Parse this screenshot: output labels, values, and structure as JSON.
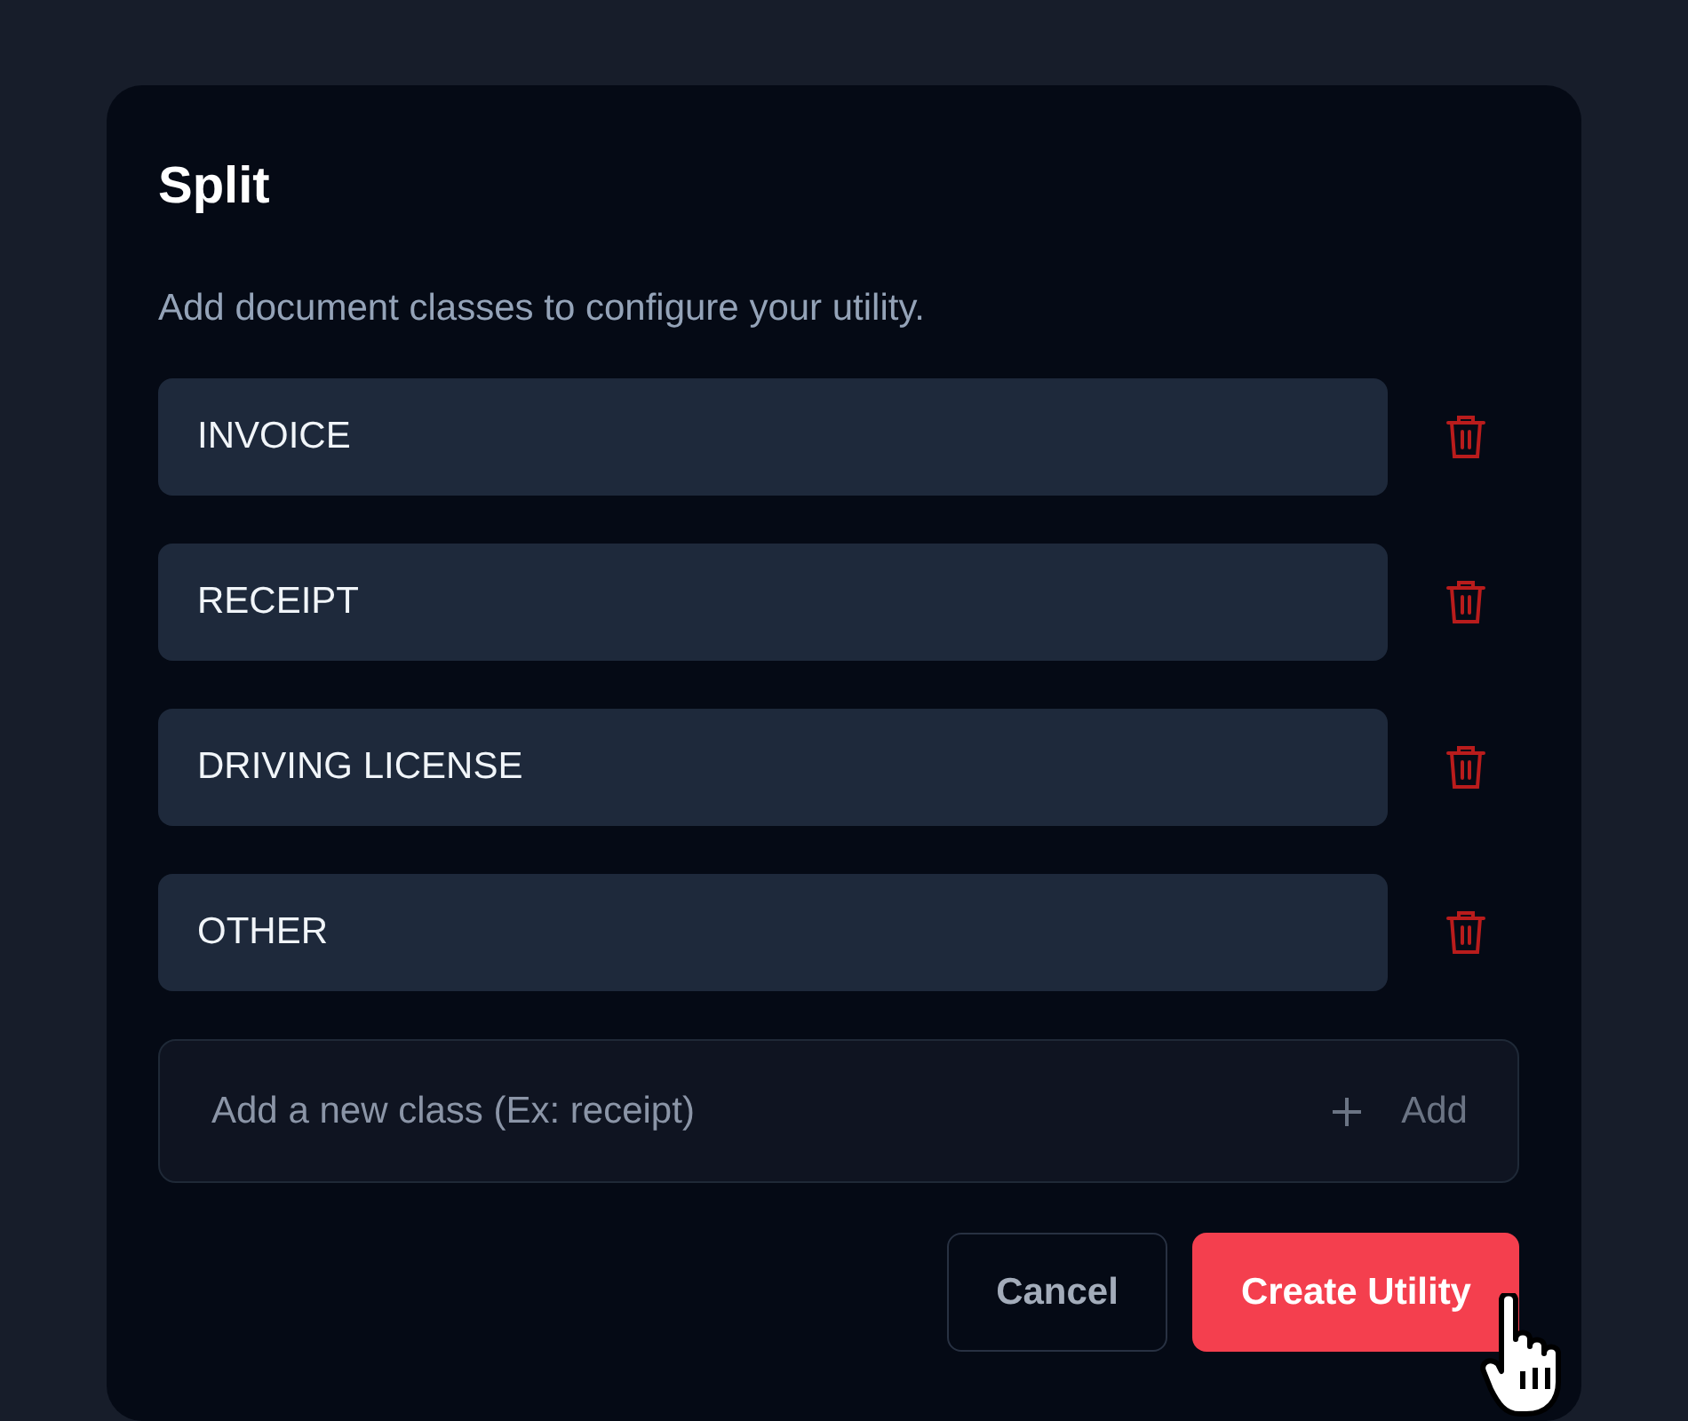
{
  "dialog": {
    "title": "Split",
    "description": "Add document classes to configure your utility.",
    "classes": [
      {
        "value": "INVOICE"
      },
      {
        "value": "RECEIPT"
      },
      {
        "value": "DRIVING LICENSE"
      },
      {
        "value": "OTHER"
      }
    ],
    "new_class": {
      "placeholder": "Add a new class (Ex: receipt)",
      "add_label": "Add"
    },
    "buttons": [
      {
        "label": "Cancel",
        "kind": "secondary"
      },
      {
        "label": "Create Utility",
        "kind": "primary"
      }
    ]
  }
}
